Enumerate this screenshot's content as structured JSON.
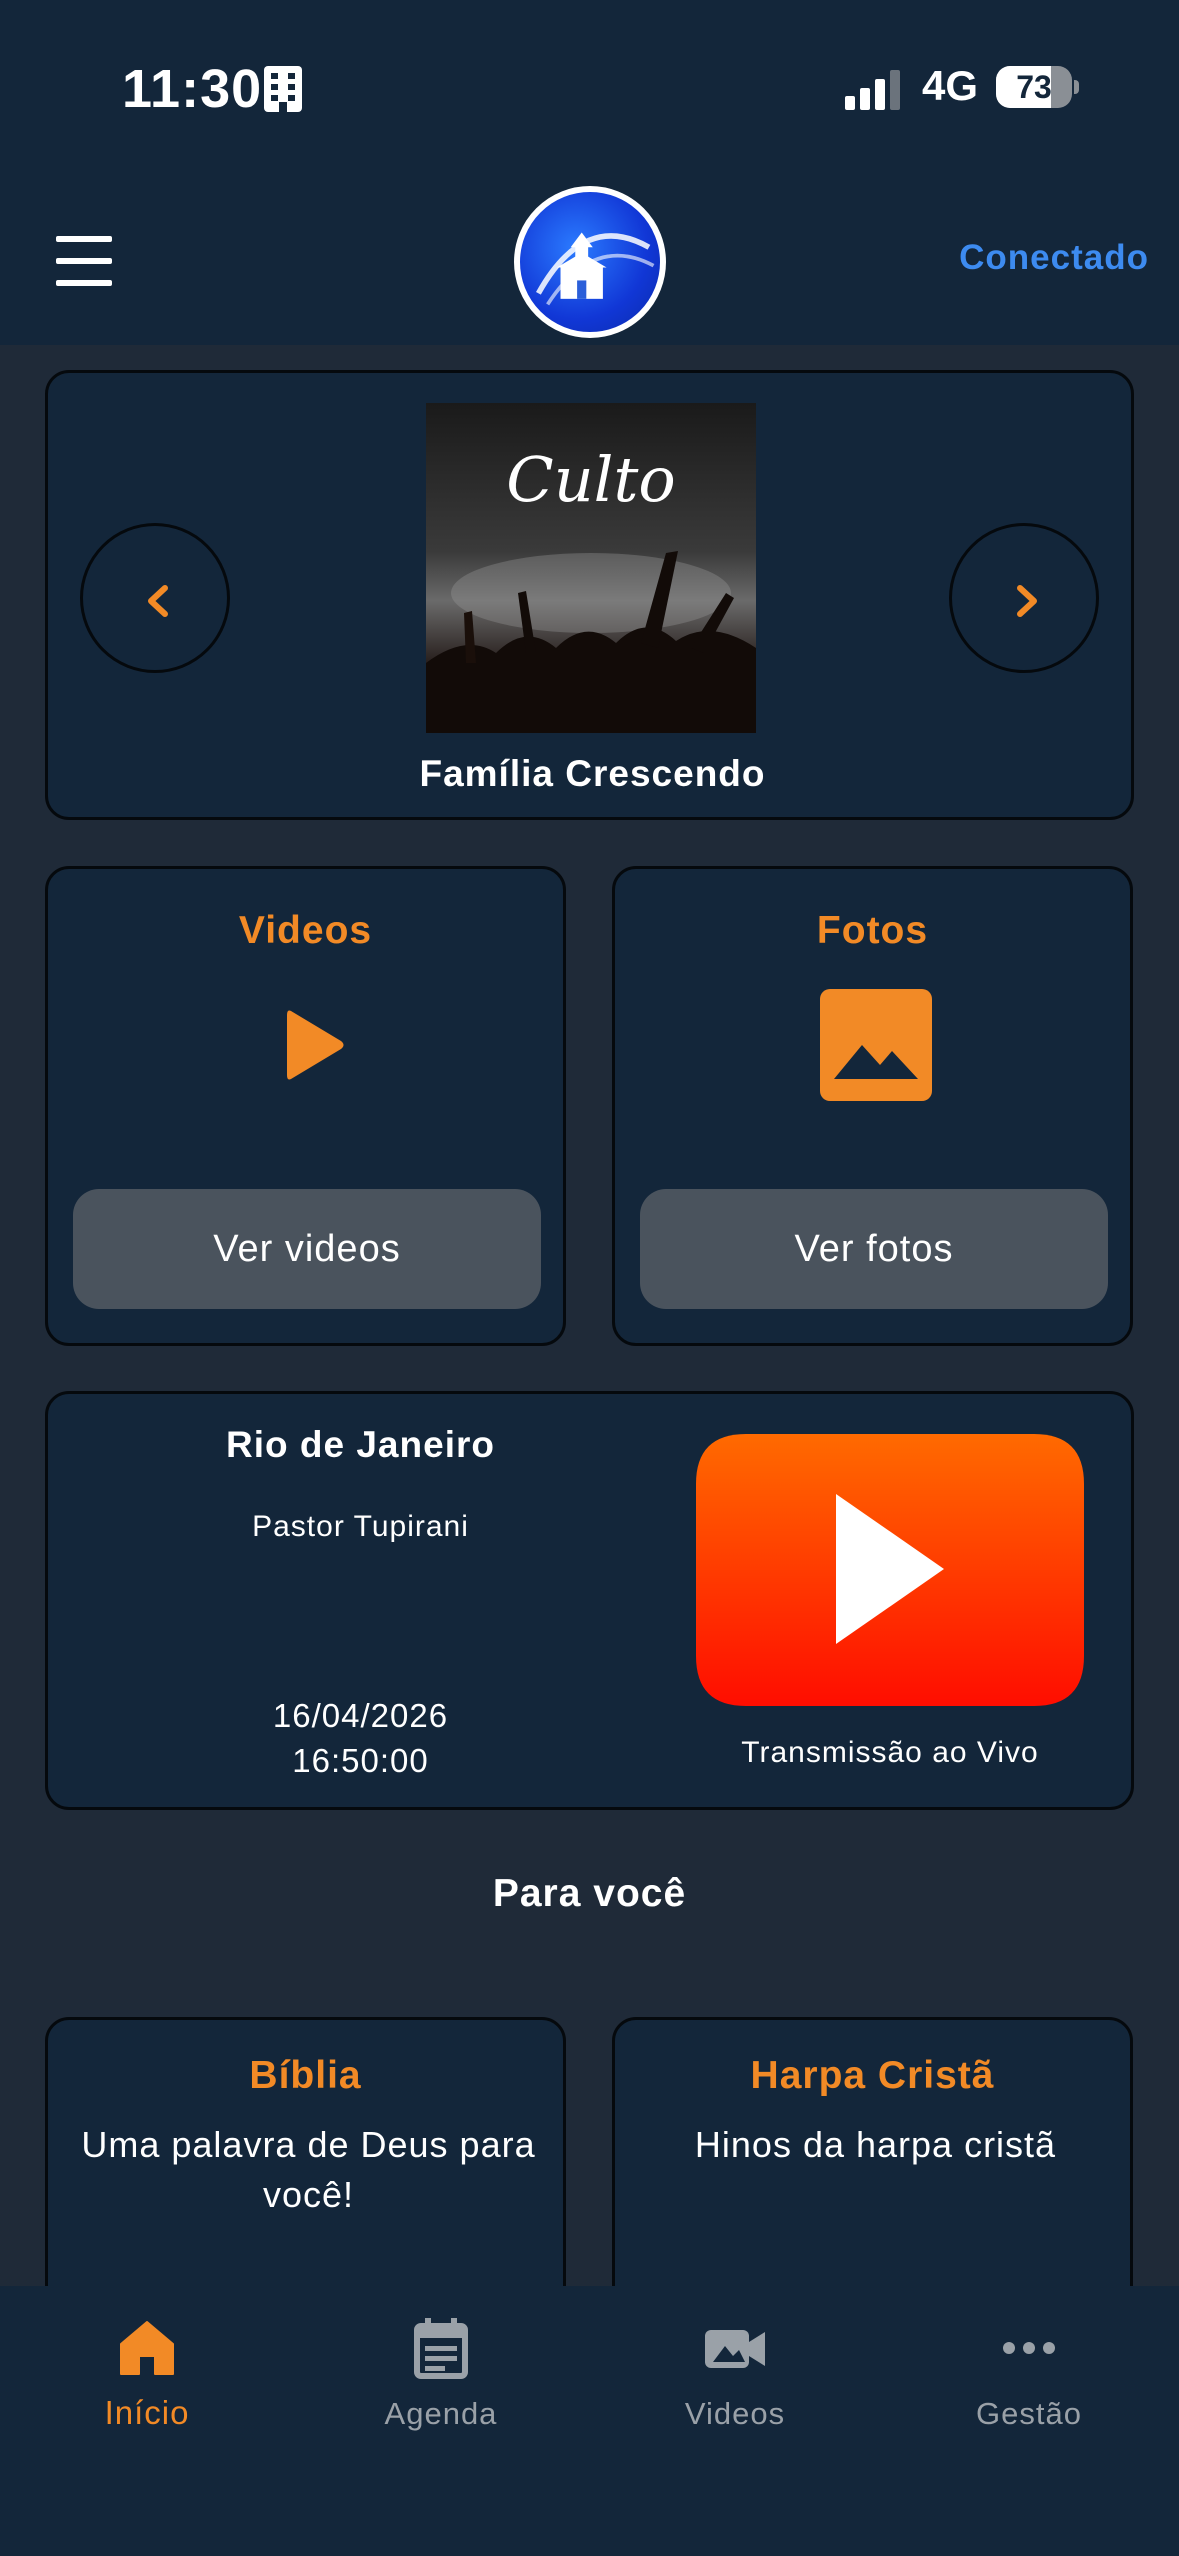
{
  "status_bar": {
    "time": "11:30",
    "network": "4G",
    "battery_percent": "73",
    "battery_level": 0.73
  },
  "header": {
    "menu_icon": "hamburger-menu-icon",
    "logo_icon": "church-logo-icon",
    "connection_status": "Conectado"
  },
  "featured": {
    "image_caption": "Culto",
    "title": "Família Crescendo",
    "prev_icon": "chevron-left-icon",
    "next_icon": "chevron-right-icon"
  },
  "media": {
    "videos": {
      "title": "Videos",
      "icon": "play-icon",
      "button_label": "Ver videos"
    },
    "fotos": {
      "title": "Fotos",
      "icon": "image-icon",
      "button_label": "Ver fotos"
    }
  },
  "live": {
    "city": "Rio de Janeiro",
    "pastor": "Pastor Tupirani",
    "date": "16/04/2026",
    "time": "16:50:00",
    "icon": "youtube-play-icon",
    "label": "Transmissão ao Vivo"
  },
  "for_you": {
    "title": "Para você",
    "cards": [
      {
        "title": "Bíblia",
        "description": "Uma palavra de Deus para você!"
      },
      {
        "title": "Harpa Cristã",
        "description": "Hinos da harpa cristã"
      }
    ]
  },
  "tabbar": {
    "tabs": [
      {
        "label": "Início",
        "icon": "home-icon",
        "active": true
      },
      {
        "label": "Agenda",
        "icon": "calendar-icon",
        "active": false
      },
      {
        "label": "Videos",
        "icon": "video-camera-icon",
        "active": false
      },
      {
        "label": "Gestão",
        "icon": "more-dots-icon",
        "active": false
      }
    ]
  },
  "colors": {
    "background": "#1f2a38",
    "surface": "#13263a",
    "accent": "#f28a26",
    "link": "#3d8bf0",
    "button": "#4a535d",
    "inactive": "#9aa1a8",
    "youtube_red": "#ff2a00"
  }
}
